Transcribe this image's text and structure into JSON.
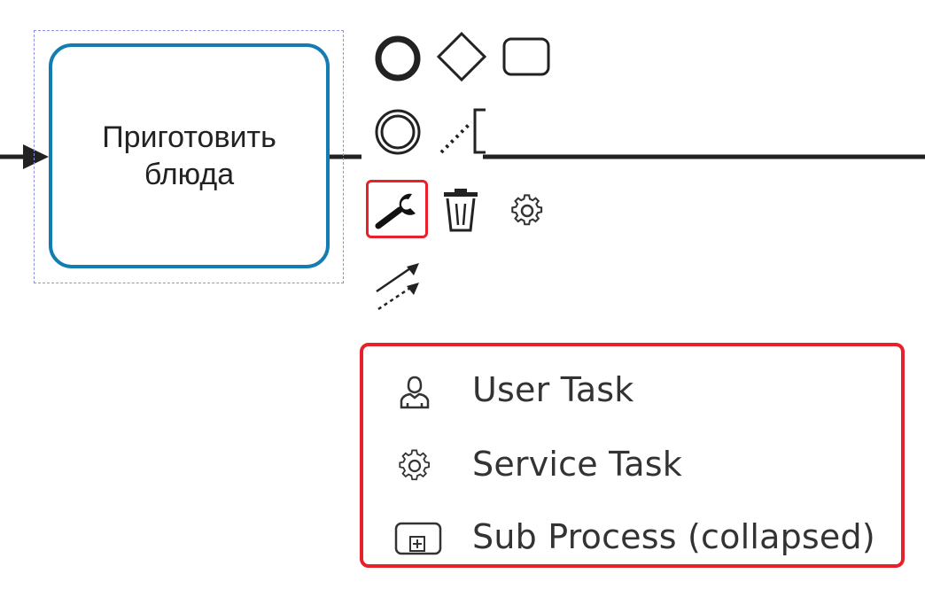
{
  "task": {
    "label": "Приготовить\nблюда"
  },
  "context_pad": {
    "entries": [
      {
        "name": "end-event",
        "icon": "end-event-icon"
      },
      {
        "name": "gateway",
        "icon": "gateway-icon"
      },
      {
        "name": "task",
        "icon": "task-icon"
      },
      {
        "name": "intermediate-event",
        "icon": "intermediate-event-icon"
      },
      {
        "name": "text-annotation",
        "icon": "text-annotation-icon"
      },
      {
        "name": "replace",
        "icon": "wrench-icon",
        "highlighted": true
      },
      {
        "name": "delete",
        "icon": "trash-icon"
      },
      {
        "name": "append-service",
        "icon": "gear-icon"
      },
      {
        "name": "connect",
        "icon": "connect-arrows-icon"
      }
    ]
  },
  "replace_menu": {
    "items": [
      {
        "label": "User Task",
        "icon": "user-icon"
      },
      {
        "label": "Service Task",
        "icon": "gear-icon"
      },
      {
        "label": "Sub Process (collapsed)",
        "icon": "subprocess-icon"
      }
    ]
  },
  "colors": {
    "task_border": "#137db3",
    "highlight": "#e8202a",
    "selection": "#8f8fe6"
  }
}
